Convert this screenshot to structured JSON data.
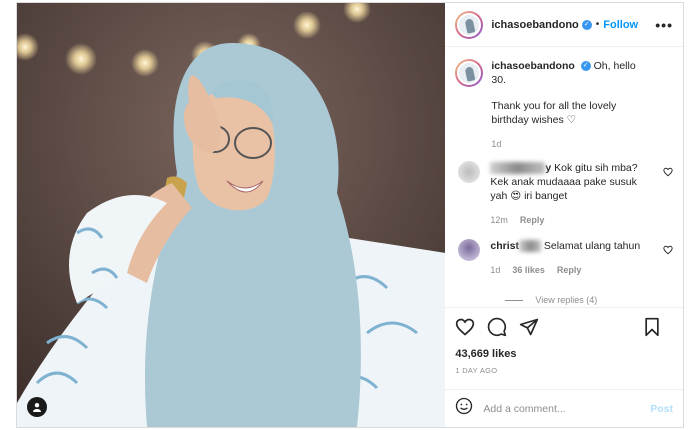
{
  "post": {
    "username": "ichasoebandono",
    "follow_label": "Follow",
    "follow_separator": "•",
    "more_label": "•••",
    "verified_mark": "✓",
    "caption_line1": "Oh, hello 30.",
    "caption_line2": "Thank you for all the lovely birthday wishes ♡",
    "caption_time": "1d",
    "likes": "43,669 likes",
    "time_ago": "1 DAY AGO",
    "add_comment_placeholder": "Add a comment...",
    "post_label": "Post"
  },
  "comments": [
    {
      "username_suffix": "y",
      "text": "Kok gitu sih mba? Kek anak mudaaaa pake susuk yah 😍 iri banget",
      "time": "12m",
      "reply_label": "Reply"
    },
    {
      "username_prefix": "christ",
      "text": "Selamat ulang tahun",
      "time": "1d",
      "likes": "36 likes",
      "reply_label": "Reply",
      "view_replies": "View replies (4)"
    }
  ],
  "icons": [
    "heart-icon",
    "comment-icon",
    "share-icon",
    "bookmark-icon",
    "emoji-icon",
    "user-tag-icon",
    "more-icon",
    "verified-icon"
  ],
  "colors": {
    "accent": "#0095f6",
    "post_disabled": "#b2dffc",
    "meta": "#8e8e8e"
  }
}
